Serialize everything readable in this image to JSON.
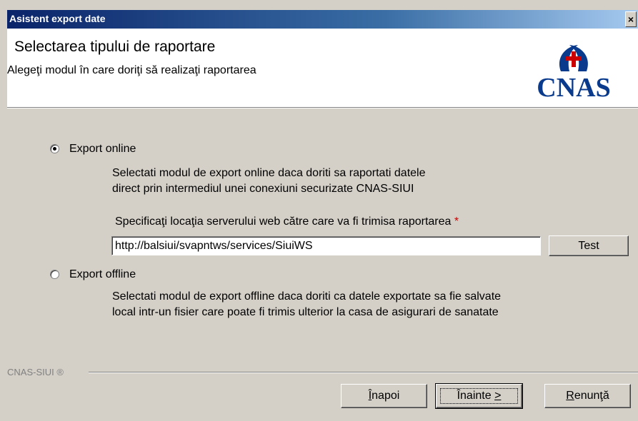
{
  "window": {
    "title": "Asistent export date",
    "close_glyph": "×"
  },
  "header": {
    "title": "Selectarea tipului de raportare",
    "subtitle": "Alegeţi modul în care doriţi să realizaţi raportarea",
    "logo_text": "CNAS",
    "logo_color": "#0a3a8c",
    "logo_accent": "#cc0000"
  },
  "options": {
    "online": {
      "label": "Export online",
      "desc_line1": "Selectati modul de export online daca doriti sa raportati datele",
      "desc_line2": "direct prin intermediul unei conexiuni securizate CNAS-SIUI",
      "selected": true
    },
    "server": {
      "label": "Specificaţi locaţia serverului web către care va fi trimisa raportarea",
      "required_mark": "*",
      "value": "http://balsiui/svapntws/services/SiuiWS",
      "test_label": "Test"
    },
    "offline": {
      "label": "Export offline",
      "desc_line1": "Selectati modul de export offline daca doriti ca datele exportate sa fie salvate",
      "desc_line2": "local intr-un fisier care poate fi trimis ulterior la casa de asigurari de sanatate",
      "selected": false
    }
  },
  "footer": {
    "brand": "CNAS-SIUI ®",
    "back": {
      "accel": "Î",
      "rest": "napoi"
    },
    "next": {
      "text": "Înainte ",
      "accel": ">"
    },
    "cancel": {
      "accel": "R",
      "rest": "enunţă"
    }
  }
}
